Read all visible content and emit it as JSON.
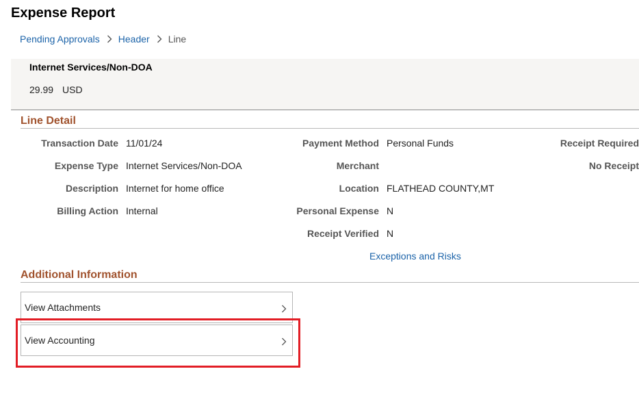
{
  "header": {
    "title": "Expense Report"
  },
  "breadcrumb": {
    "items": [
      {
        "label": "Pending Approvals"
      },
      {
        "label": "Header"
      },
      {
        "label": "Line"
      }
    ]
  },
  "summary": {
    "expense_type": "Internet Services/Non-DOA",
    "amount": "29.99",
    "currency": "USD"
  },
  "line_detail": {
    "section_title": "Line Detail",
    "fields": {
      "transaction_date": {
        "label": "Transaction Date",
        "value": "11/01/24"
      },
      "expense_type": {
        "label": "Expense Type",
        "value": "Internet Services/Non-DOA"
      },
      "description": {
        "label": "Description",
        "value": "Internet for home office"
      },
      "billing_action": {
        "label": "Billing Action",
        "value": "Internal"
      },
      "payment_method": {
        "label": "Payment Method",
        "value": "Personal Funds"
      },
      "merchant": {
        "label": "Merchant",
        "value": ""
      },
      "location": {
        "label": "Location",
        "value": "FLATHEAD COUNTY,MT"
      },
      "personal_expense": {
        "label": "Personal Expense",
        "value": "N"
      },
      "receipt_verified": {
        "label": "Receipt Verified",
        "value": "N"
      },
      "receipt_required": {
        "label": "Receipt Required"
      },
      "no_receipt": {
        "label": "No Receipt"
      }
    },
    "exceptions_link": "Exceptions and Risks"
  },
  "additional_information": {
    "section_title": "Additional Information",
    "items": [
      {
        "label": "View Attachments"
      },
      {
        "label": "View Accounting"
      }
    ]
  },
  "annotation": {
    "highlight_color": "#e21d25"
  },
  "colors": {
    "link": "#1a62a8",
    "section_heading": "#a0522d",
    "summary_background": "#f6f5f3"
  }
}
